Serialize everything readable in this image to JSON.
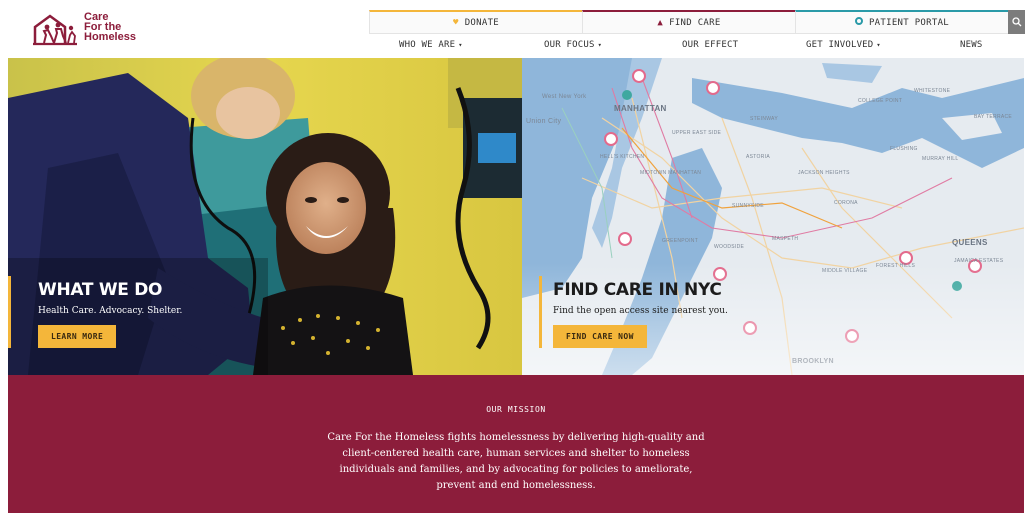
{
  "brand": {
    "name_lines": [
      "Care",
      "For the",
      "Homeless"
    ],
    "color": "#8c1d3b"
  },
  "utility_nav": {
    "donate": {
      "label": "DONATE",
      "icon": "heart-icon",
      "color": "#f4b63a"
    },
    "find_care": {
      "label": "FIND CARE",
      "icon": "warning-triangle-icon",
      "color": "#8c1d3b"
    },
    "patient_portal": {
      "label": "PATIENT PORTAL",
      "icon": "circle-icon",
      "color": "#2a9aa8"
    },
    "search": {
      "icon": "search-icon"
    }
  },
  "main_nav": [
    {
      "label": "WHO WE ARE",
      "has_dropdown": true
    },
    {
      "label": "OUR FOCUS",
      "has_dropdown": true
    },
    {
      "label": "OUR EFFECT",
      "has_dropdown": false
    },
    {
      "label": "GET INVOLVED",
      "has_dropdown": true
    },
    {
      "label": "NEWS",
      "has_dropdown": false
    }
  ],
  "hero": {
    "left": {
      "title": "WHAT WE DO",
      "subtitle": "Health Care. Advocacy. Shelter.",
      "button": "LEARN MORE"
    },
    "right": {
      "title": "FIND CARE IN NYC",
      "subtitle": "Find the open access site nearest you.",
      "button": "FIND CARE NOW",
      "map_labels": [
        "MANHATTAN",
        "Union City",
        "UPPER EAST SIDE",
        "ASTORIA",
        "QUEENS",
        "COLLEGE POINT",
        "WHITESTONE",
        "BAY TERRACE",
        "FLUSHING",
        "MURRAY HILL",
        "JACKSON HEIGHTS",
        "CORONA",
        "BROOKLYN",
        "West New York",
        "SUNNYSIDE",
        "MASPETH",
        "WOODSIDE",
        "MIDDLE VILLAGE",
        "FOREST HILLS",
        "JAMAICA ESTATES",
        "STEINWAY",
        "HELL'S KITCHEN",
        "MIDTOWN MANHATTAN",
        "GREENPOINT"
      ]
    }
  },
  "mission": {
    "label": "OUR MISSION",
    "text": "Care For the Homeless fights homelessness by delivering high-quality and client-centered health care, human services and shelter to homeless individuals and families, and by advocating for policies to ameliorate, prevent and end homelessness."
  },
  "colors": {
    "accent_yellow": "#f4b63a",
    "brand_maroon": "#8c1d3b",
    "teal": "#2a9aa8"
  }
}
